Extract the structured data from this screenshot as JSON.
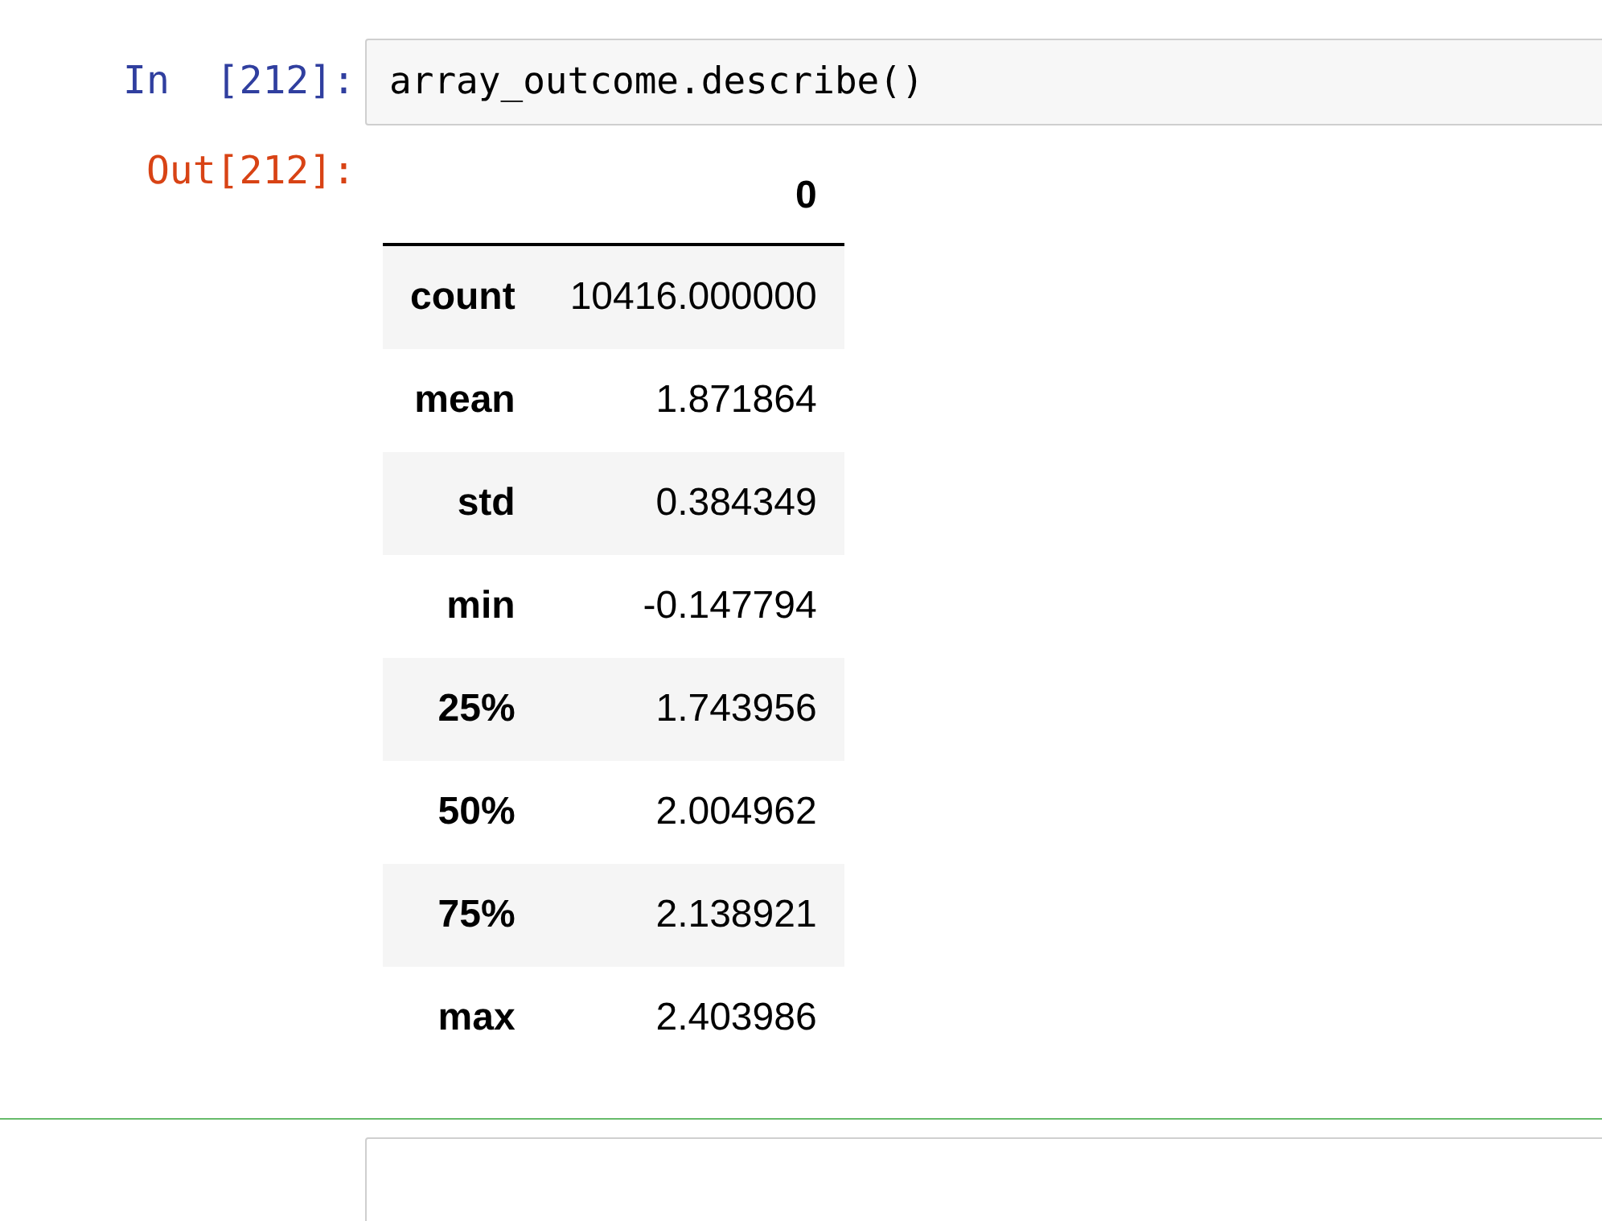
{
  "cells": [
    {
      "selected": false,
      "prompt": "In  [212]:",
      "source": "array_outcome.describe()",
      "out_prompt": "Out[212]:",
      "table": {
        "columns": [
          "0"
        ],
        "rows": [
          {
            "label": "count",
            "values": [
              "10416.000000"
            ]
          },
          {
            "label": "mean",
            "values": [
              "1.871864"
            ]
          },
          {
            "label": "std",
            "values": [
              "0.384349"
            ]
          },
          {
            "label": "min",
            "values": [
              "-0.147794"
            ]
          },
          {
            "label": "25%",
            "values": [
              "1.743956"
            ]
          },
          {
            "label": "50%",
            "values": [
              "2.004962"
            ]
          },
          {
            "label": "75%",
            "values": [
              "2.138921"
            ]
          },
          {
            "label": "max",
            "values": [
              "2.403986"
            ]
          }
        ]
      }
    },
    {
      "selected": true
    }
  ]
}
